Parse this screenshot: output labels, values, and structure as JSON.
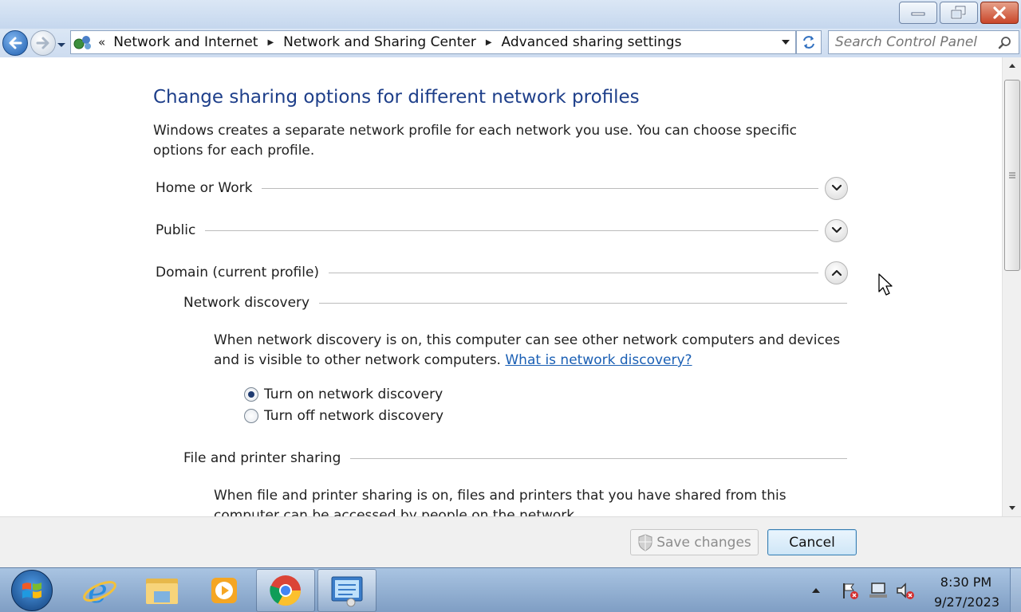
{
  "window": {
    "controls": [
      "minimize",
      "restore",
      "close"
    ]
  },
  "navigation": {
    "address_overflow": "«",
    "breadcrumbs": [
      "Network and Internet",
      "Network and Sharing Center",
      "Advanced sharing settings"
    ],
    "search_placeholder": "Search Control Panel"
  },
  "main": {
    "title": "Change sharing options for different network profiles",
    "description": "Windows creates a separate network profile for each network you use. You can choose specific options for each profile.",
    "profiles": [
      {
        "label": "Home or Work",
        "expanded": false
      },
      {
        "label": "Public",
        "expanded": false
      },
      {
        "label": "Domain (current profile)",
        "expanded": true
      }
    ],
    "network_discovery": {
      "heading": "Network discovery",
      "text": "When network discovery is on, this computer can see other network computers and devices and is visible to other network computers. ",
      "link": "What is network discovery?",
      "options": [
        {
          "label": "Turn on network discovery",
          "selected": true
        },
        {
          "label": "Turn off network discovery",
          "selected": false
        }
      ]
    },
    "file_printer_sharing": {
      "heading": "File and printer sharing",
      "text": "When file and printer sharing is on, files and printers that you have shared from this computer can be accessed by people on the network."
    }
  },
  "footer": {
    "save_label": "Save changes",
    "cancel_label": "Cancel"
  },
  "taskbar": {
    "apps": [
      "internet-explorer",
      "windows-explorer",
      "media-player",
      "chrome",
      "control-panel"
    ],
    "clock_time": "8:30 PM",
    "clock_date": "9/27/2023"
  },
  "colors": {
    "title": "#1e3f8a",
    "link": "#1a5fb4"
  }
}
